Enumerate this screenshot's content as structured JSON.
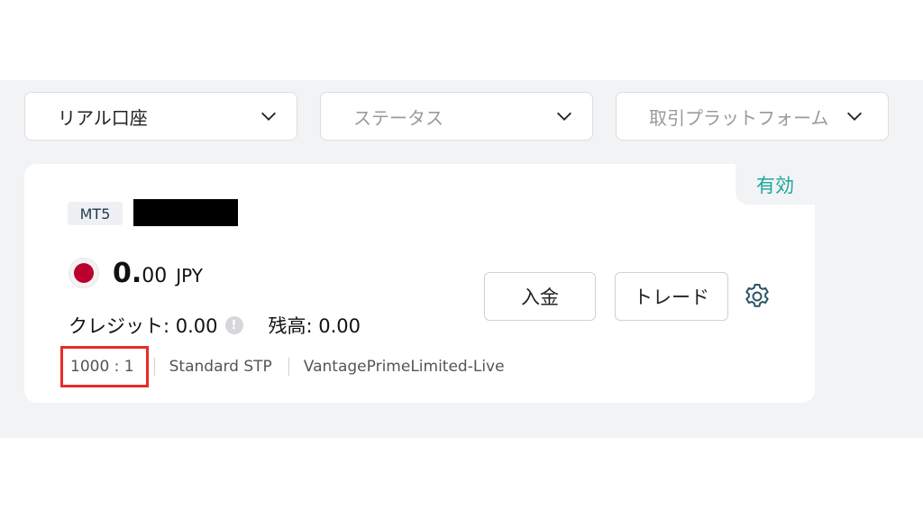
{
  "filters": [
    {
      "label": "リアル口座",
      "placeholder": false
    },
    {
      "label": "ステータス",
      "placeholder": true
    },
    {
      "label": "取引プラットフォーム",
      "placeholder": true
    }
  ],
  "account": {
    "status": "有効",
    "platform": "MT5",
    "balance_int": "0.",
    "balance_dec": "00",
    "currency": "JPY",
    "credit_label": "クレジット: 0.00",
    "credit_info": "!",
    "remaining_label": "残高:  0.00",
    "leverage": "1000 : 1",
    "account_type": "Standard STP",
    "server": "VantagePrimeLimited-Live",
    "flag": "japan-flag-icon"
  },
  "actions": {
    "deposit": "入金",
    "trade": "トレード",
    "settings_icon": "gear-icon"
  },
  "colors": {
    "status_green": "#1aa79b",
    "highlight_red": "#e82b2b",
    "panel_bg": "#f2f3f5"
  }
}
